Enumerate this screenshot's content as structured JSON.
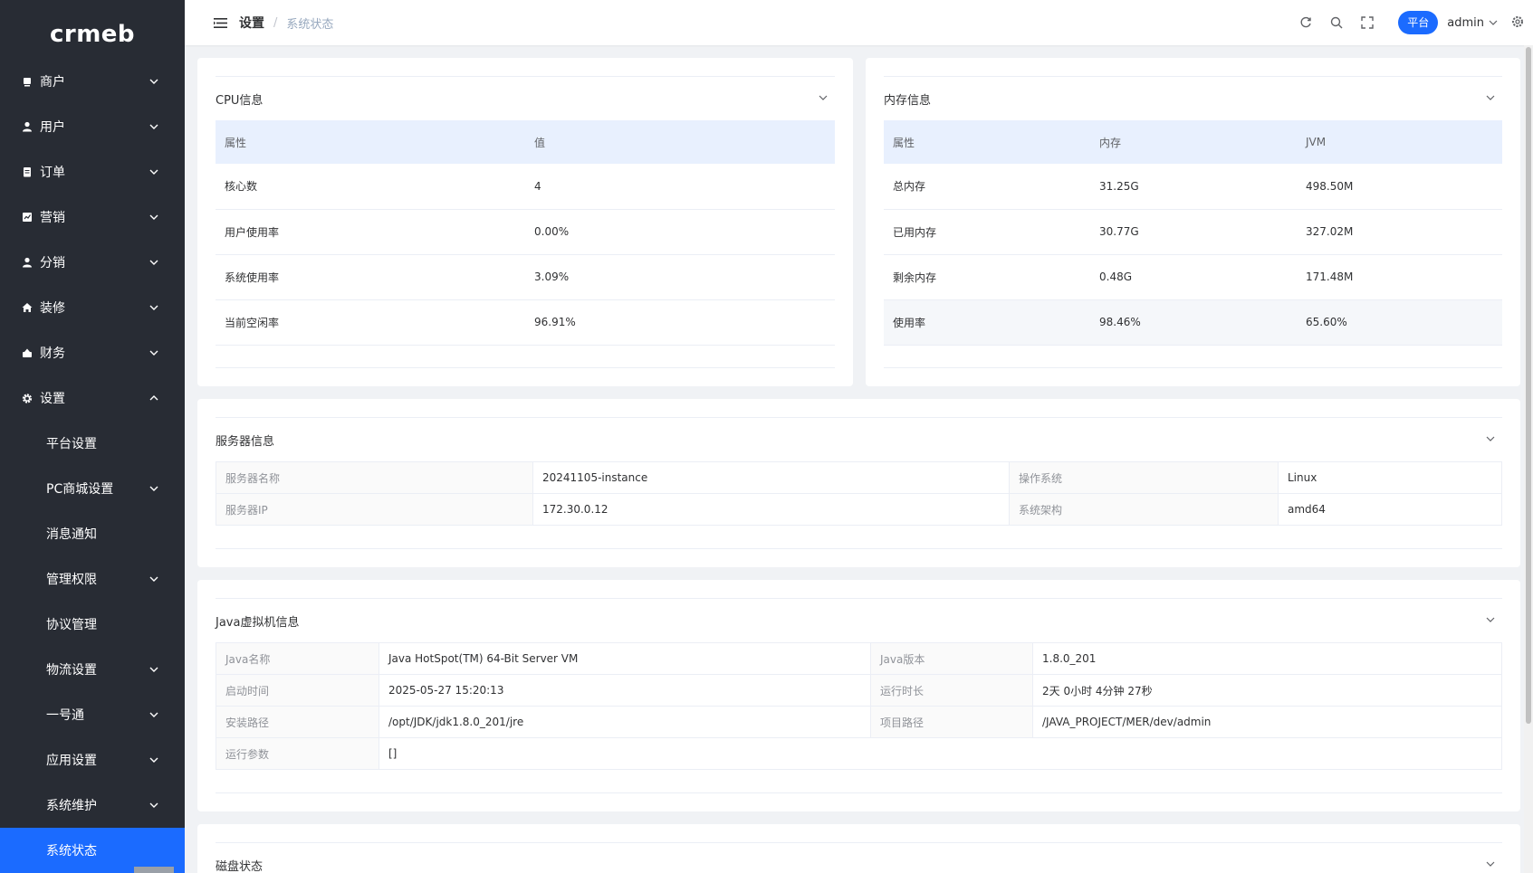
{
  "sidebar": {
    "logo": "crmeb",
    "items": [
      {
        "label": "商户",
        "icon": "shop-icon"
      },
      {
        "label": "用户",
        "icon": "user-icon"
      },
      {
        "label": "订单",
        "icon": "order-icon"
      },
      {
        "label": "营销",
        "icon": "marketing-icon"
      },
      {
        "label": "分销",
        "icon": "distribution-icon"
      },
      {
        "label": "装修",
        "icon": "home-icon"
      },
      {
        "label": "财务",
        "icon": "finance-icon"
      },
      {
        "label": "设置",
        "icon": "gear-icon"
      }
    ],
    "subitems": [
      {
        "label": "平台设置"
      },
      {
        "label": "PC商城设置"
      },
      {
        "label": "消息通知"
      },
      {
        "label": "管理权限"
      },
      {
        "label": "协议管理"
      },
      {
        "label": "物流设置"
      },
      {
        "label": "一号通"
      },
      {
        "label": "应用设置"
      },
      {
        "label": "系统维护"
      },
      {
        "label": "系统状态"
      }
    ]
  },
  "header": {
    "breadcrumb": [
      "设置",
      "系统状态"
    ],
    "platform_label": "平台",
    "user": "admin"
  },
  "cpu": {
    "title": "CPU信息",
    "headers": [
      "属性",
      "值"
    ],
    "rows": [
      [
        "核心数",
        "4"
      ],
      [
        "用户使用率",
        "0.00%"
      ],
      [
        "系统使用率",
        "3.09%"
      ],
      [
        "当前空闲率",
        "96.91%"
      ]
    ]
  },
  "memory": {
    "title": "内存信息",
    "headers": [
      "属性",
      "内存",
      "JVM"
    ],
    "rows": [
      [
        "总内存",
        "31.25G",
        "498.50M"
      ],
      [
        "已用内存",
        "30.77G",
        "327.02M"
      ],
      [
        "剩余内存",
        "0.48G",
        "171.48M"
      ],
      [
        "使用率",
        "98.46%",
        "65.60%"
      ]
    ]
  },
  "server": {
    "title": "服务器信息",
    "rows": [
      [
        "服务器名称",
        "20241105-instance",
        "操作系统",
        "Linux"
      ],
      [
        "服务器IP",
        "172.30.0.12",
        "系统架构",
        "amd64"
      ]
    ]
  },
  "jvm": {
    "title": "Java虚拟机信息",
    "rows": [
      [
        "Java名称",
        "Java HotSpot(TM) 64-Bit Server VM",
        "Java版本",
        "1.8.0_201"
      ],
      [
        "启动时间",
        "2025-05-27 15:20:13",
        "运行时长",
        "2天 0小时 4分钟 27秒"
      ],
      [
        "安装路径",
        "/opt/JDK/jdk1.8.0_201/jre",
        "项目路径",
        "/JAVA_PROJECT/MER/dev/admin"
      ],
      [
        "运行参数",
        "[]"
      ]
    ]
  },
  "disk": {
    "title": "磁盘状态"
  }
}
